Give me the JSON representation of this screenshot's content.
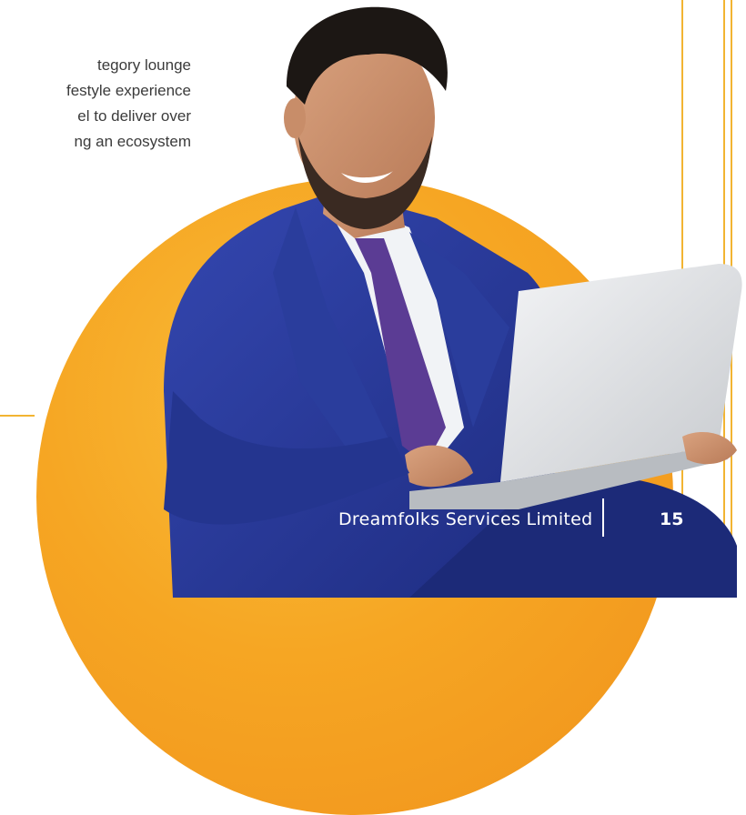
{
  "intro": {
    "lines": [
      "tegory lounge",
      "festyle experience",
      "el to deliver over",
      "ng an ecosystem"
    ]
  },
  "footer": {
    "company": "Dreamfolks Services Limited",
    "page_number": "15"
  },
  "colors": {
    "accent_orange": "#f6a623",
    "accent_gold": "#f2b432",
    "suit_blue": "#2a3d9c",
    "text_gray": "#3b3b3b"
  }
}
